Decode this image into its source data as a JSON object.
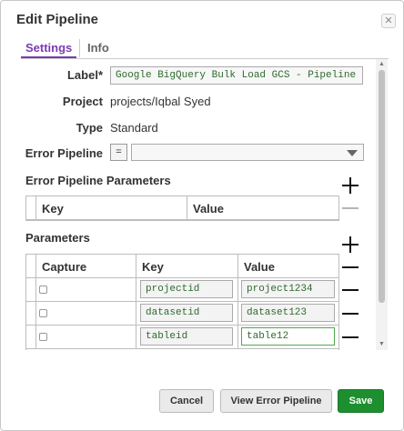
{
  "dialog": {
    "title": "Edit Pipeline",
    "close_glyph": "✕"
  },
  "tabs": [
    {
      "label": "Settings",
      "active": true
    },
    {
      "label": "Info",
      "active": false
    }
  ],
  "fields": {
    "label": {
      "label": "Label*",
      "value": "Google BigQuery Bulk Load GCS - Pipeline params"
    },
    "project": {
      "label": "Project",
      "value": "projects/Iqbal Syed"
    },
    "type": {
      "label": "Type",
      "value": "Standard"
    },
    "error_pipeline": {
      "label": "Error Pipeline",
      "expr_toggle": "=",
      "value": ""
    }
  },
  "error_pipeline_parameters": {
    "title": "Error Pipeline Parameters",
    "columns": [
      "Key",
      "Value"
    ],
    "rows": []
  },
  "parameters": {
    "title": "Parameters",
    "columns": [
      "Capture",
      "Key",
      "Value"
    ],
    "rows": [
      {
        "capture": false,
        "key": "projectid",
        "value": "project1234"
      },
      {
        "capture": false,
        "key": "datasetid",
        "value": "dataset123"
      },
      {
        "capture": false,
        "key": "tableid",
        "value": "table12"
      }
    ]
  },
  "footer": {
    "cancel": "Cancel",
    "view_error_pipeline": "View Error Pipeline",
    "save": "Save"
  },
  "colors": {
    "accent": "#7a3bb0",
    "save_green": "#1e8f2f",
    "value_text_green": "#2d6a2d"
  },
  "icons": [
    "close-icon",
    "plus-icon",
    "minus-icon",
    "dropdown-caret-icon",
    "scroll-up-icon",
    "scroll-down-icon"
  ]
}
